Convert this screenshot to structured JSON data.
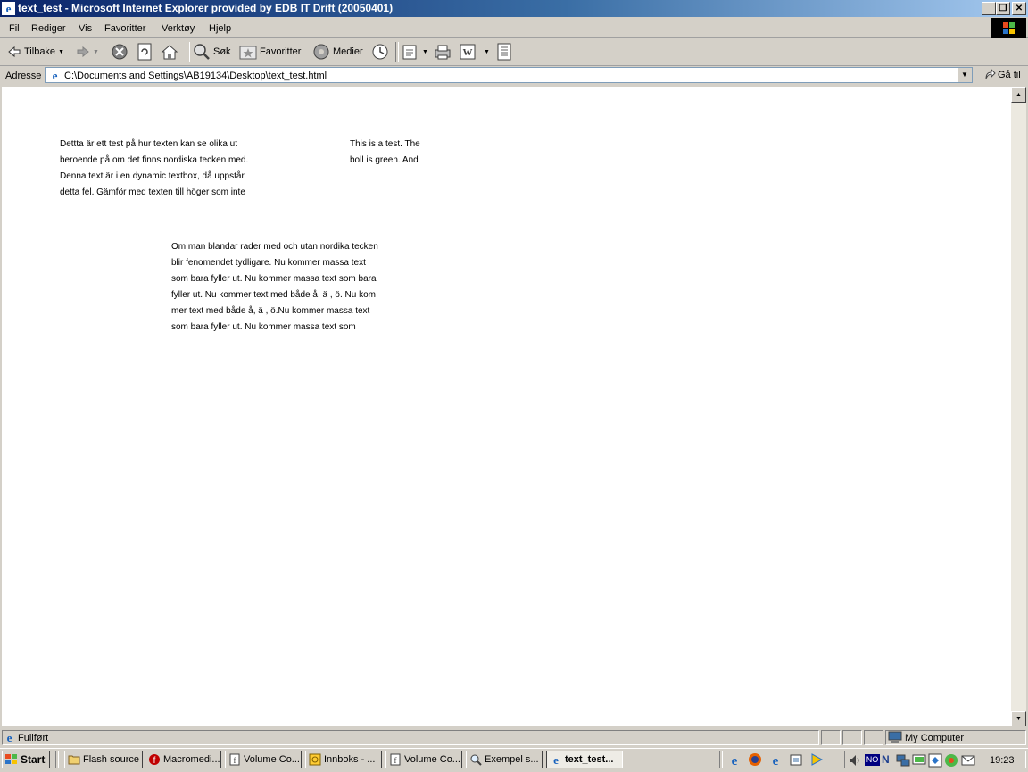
{
  "window": {
    "title": "text_test - Microsoft Internet Explorer provided by EDB IT Drift (20050401)",
    "minimize": "_",
    "restore": "❐",
    "close": "✕"
  },
  "menu": {
    "items": [
      "Fil",
      "Rediger",
      "Vis",
      "Favoritter",
      "Verktøy",
      "Hjelp"
    ]
  },
  "toolbar": {
    "back": "Tilbake",
    "search": "Søk",
    "favorites": "Favoritter",
    "media": "Medier"
  },
  "address": {
    "label": "Adresse",
    "value": "C:\\Documents and Settings\\AB19134\\Desktop\\text_test.html",
    "go": "Gå til"
  },
  "content": {
    "block1": [
      "Dettta är ett test på hur texten kan se olika ut",
      "beroende på om det finns nordiska tecken med.",
      "Denna text är i en dynamic textbox, då uppstår",
      "detta fel. Gämför med texten till höger som inte"
    ],
    "block2": [
      "This is a test. The",
      "boll is green. And"
    ],
    "block3": [
      "Om man blandar rader med och utan nordika tecken",
      "blir fenomendet tydligare. Nu kommer massa text",
      "som bara fyller ut. Nu kommer massa text som bara",
      "fyller ut. Nu kommer text med både å, ä , ö. Nu kom",
      "mer text med både å, ä , ö.Nu kommer massa text",
      "som bara fyller ut. Nu kommer massa text som"
    ]
  },
  "status": {
    "text": "Fullført",
    "zone": "My Computer"
  },
  "taskbar": {
    "start": "Start",
    "tasks": [
      {
        "label": "Flash source",
        "icon": "folder-icon"
      },
      {
        "label": "Macromedi...",
        "icon": "flash-icon"
      },
      {
        "label": "Volume Co...",
        "icon": "document-icon"
      },
      {
        "label": "Innboks - ...",
        "icon": "mail-icon"
      },
      {
        "label": "Volume Co...",
        "icon": "document-icon"
      },
      {
        "label": "Exempel s...",
        "icon": "search-icon"
      },
      {
        "label": "text_test...",
        "icon": "ie-icon"
      }
    ],
    "tray_lang": "NO",
    "tray_n": "N",
    "clock": "19:23"
  },
  "colors": {
    "titlebar_start": "#0a246a",
    "titlebar_end": "#a6caf0",
    "chrome": "#d4d0c8",
    "content_bg": "#ffffff"
  }
}
